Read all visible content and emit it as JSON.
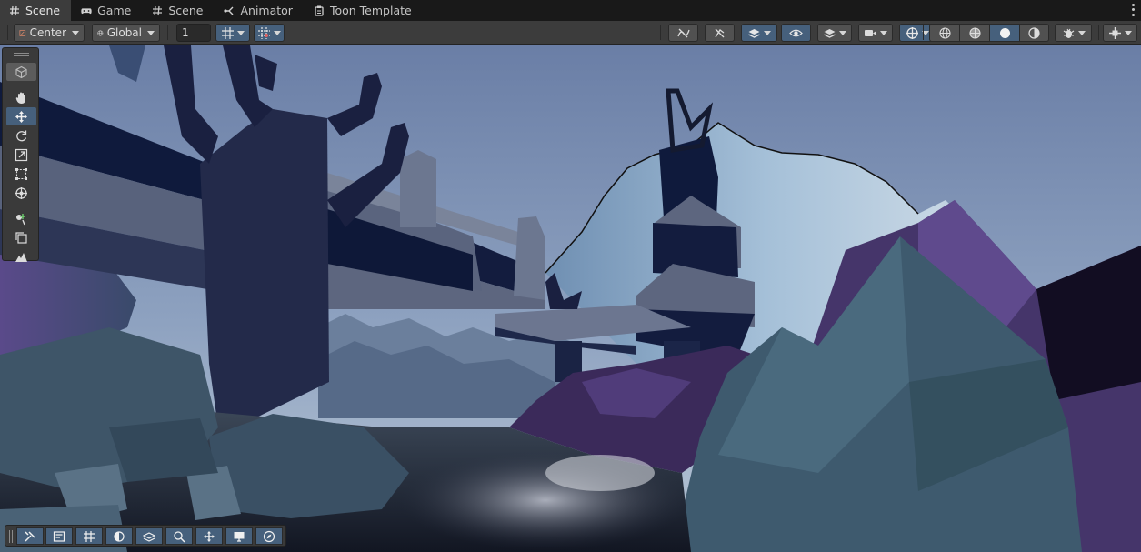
{
  "tabs": [
    {
      "label": "Scene",
      "icon": "hash-icon",
      "active": true
    },
    {
      "label": "Game",
      "icon": "gamepad-icon",
      "active": false
    },
    {
      "label": "Scene",
      "icon": "hash-icon",
      "active": false
    },
    {
      "label": "Animator",
      "icon": "animator-icon",
      "active": false
    },
    {
      "label": "Toon Template",
      "icon": "toon-icon",
      "active": false
    }
  ],
  "toolbar": {
    "pivot_mode": "Center",
    "pivot_rotation": "Global",
    "grid_snap_value": "1"
  },
  "tools": [
    {
      "name": "view",
      "icon": "view-cube-icon"
    },
    {
      "name": "hand",
      "icon": "hand-icon"
    },
    {
      "name": "move",
      "icon": "move-icon"
    },
    {
      "name": "rotate",
      "icon": "rotate-icon"
    },
    {
      "name": "scale",
      "icon": "scale-icon"
    },
    {
      "name": "rect",
      "icon": "rect-transform-icon"
    },
    {
      "name": "transform",
      "icon": "transform-icon"
    },
    {
      "name": "custom",
      "icon": "custom-tool-icon"
    },
    {
      "name": "copy",
      "icon": "copy-icon"
    },
    {
      "name": "terrain",
      "icon": "terrain-icon"
    }
  ],
  "colors": {
    "accent": "#46607c",
    "panel": "#3c3c3c",
    "tabbar": "#191919",
    "sky_top": "#6e82a8",
    "sky_low": "#a4b8cf",
    "rock": "#3e5a6e",
    "violet": "#4b3872"
  }
}
